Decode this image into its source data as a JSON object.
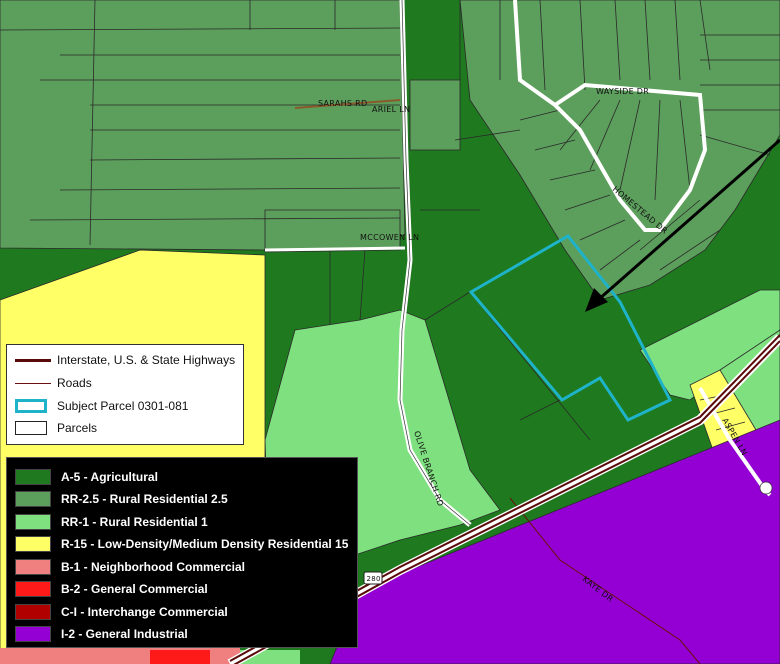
{
  "map": {
    "road_labels": {
      "sarahs_rd": "SARAHS RD",
      "ariel_ln": "ARIEL LN",
      "wayside_dr": "WAYSIDE DR",
      "homestead_dr": "HOMESTEAD DR",
      "mccowen_ln": "MCCOWEN LN",
      "olive_branch_rd": "OLIVE BRANCH RD",
      "aspen_ln": "ASPEN LN",
      "kaye_dr": "KAYE DR",
      "route_shield": "280"
    },
    "colors": {
      "agricultural": "#1f7a1f",
      "rural_residential_2_5": "#5c9e5c",
      "rural_residential_1": "#7fe07f",
      "low_density": "#ffff66",
      "neighborhood_commercial": "#f08080",
      "general_commercial": "#ff1a1a",
      "interchange_commercial": "#b00000",
      "general_industrial": "#9400d3",
      "subject_outline": "#1fb3c9",
      "highway": "#5a0a0a"
    }
  },
  "legend_features": {
    "highways": "Interstate, U.S. & State Highways",
    "roads": "Roads",
    "subject_parcel": "Subject Parcel 0301-081",
    "parcels": "Parcels"
  },
  "legend_zoning": [
    {
      "label": "A-5 - Agricultural",
      "color": "#1f7a1f"
    },
    {
      "label": "RR-2.5 - Rural Residential 2.5",
      "color": "#5c9e5c"
    },
    {
      "label": "RR-1 - Rural Residential 1",
      "color": "#7fe07f"
    },
    {
      "label": "R-15 - Low-Density/Medium Density Residential 15",
      "color": "#ffff66"
    },
    {
      "label": "B-1 - Neighborhood Commercial",
      "color": "#f08080"
    },
    {
      "label": "B-2 - General Commercial",
      "color": "#ff1a1a"
    },
    {
      "label": "C-I - Interchange Commercial",
      "color": "#b00000"
    },
    {
      "label": "I-2 - General Industrial",
      "color": "#9400d3"
    }
  ]
}
